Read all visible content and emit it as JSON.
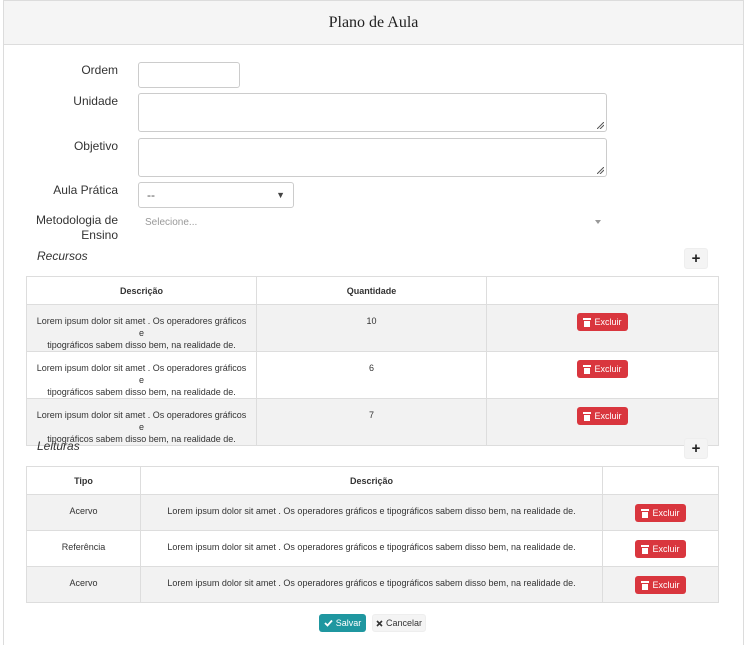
{
  "title": "Plano de Aula",
  "form": {
    "ordem_label": "Ordem",
    "ordem_value": "",
    "unidade_label": "Unidade",
    "unidade_value": "",
    "objetivo_label": "Objetivo",
    "objetivo_value": "",
    "aula_pratica_label": "Aula Prática",
    "aula_pratica_value": "--",
    "metodologia_label_line1": "Metodologia de",
    "metodologia_label_line2": "Ensino",
    "metodologia_placeholder": "Selecione..."
  },
  "recursos": {
    "title": "Recursos",
    "add_label": "+",
    "headers": [
      "Descrição",
      "Quantidade",
      ""
    ],
    "rows": [
      {
        "desc_line1": "Lorem ipsum dolor sit amet . Os operadores gráficos e",
        "desc_line2": "tipográficos sabem disso bem, na realidade de.",
        "qty": "10",
        "action": "Excluir"
      },
      {
        "desc_line1": "Lorem ipsum dolor sit amet . Os operadores gráficos e",
        "desc_line2": "tipográficos sabem disso bem, na realidade de.",
        "qty": "6",
        "action": "Excluir"
      },
      {
        "desc_line1": "Lorem ipsum dolor sit amet . Os operadores gráficos e",
        "desc_line2": "tipográficos sabem disso bem, na realidade de.",
        "qty": "7",
        "action": "Excluir"
      }
    ]
  },
  "leituras": {
    "title": "Leituras",
    "add_label": "+",
    "headers": [
      "Tipo",
      "Descrição",
      ""
    ],
    "rows": [
      {
        "tipo": "Acervo",
        "desc": "Lorem ipsum dolor sit amet . Os operadores gráficos e tipográficos sabem disso bem, na realidade de.",
        "action": "Excluir"
      },
      {
        "tipo": "Referência",
        "desc": "Lorem ipsum dolor sit amet . Os operadores gráficos e tipográficos sabem disso bem, na realidade de.",
        "action": "Excluir"
      },
      {
        "tipo": "Acervo",
        "desc": "Lorem ipsum dolor sit amet . Os operadores gráficos e tipográficos sabem disso bem, na realidade de.",
        "action": "Excluir"
      }
    ]
  },
  "footer": {
    "save_label": "Salvar",
    "cancel_label": "Cancelar"
  },
  "colors": {
    "danger": "#d9363e",
    "primary": "#1f97a0",
    "row_stripe": "#f2f2f2"
  },
  "icons": {
    "save": "check-icon",
    "cancel": "x-icon",
    "delete": "trash-icon",
    "add": "plus-icon"
  }
}
